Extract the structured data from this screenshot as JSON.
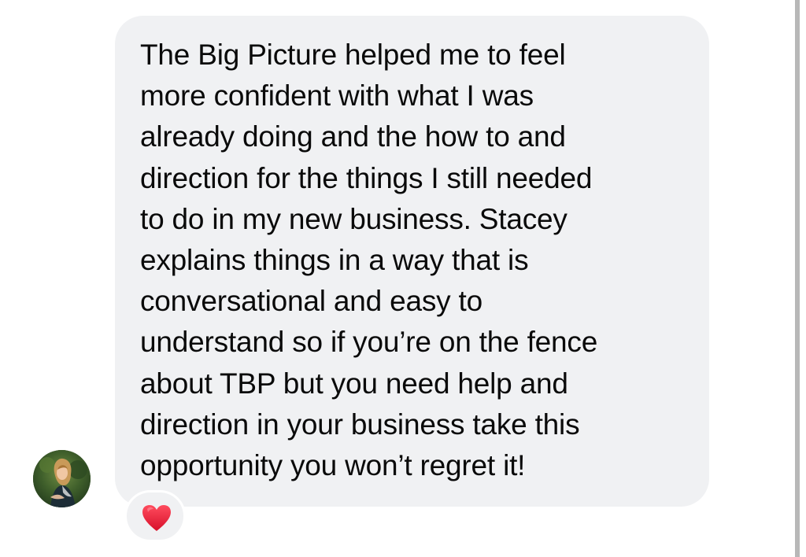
{
  "message": {
    "text": "The Big Picture helped me to feel\nmore confident with what I was\nalready doing and the how to and\ndirection for the things I still needed\nto do in my new business. Stacey\nexplains things in a way that is\nconversational and easy to\nunderstand so if you’re on the fence\nabout TBP but you need help and\ndirection in your business take this\nopportunity you won’t regret it!",
    "bubble_color": "#f0f1f3",
    "text_color": "#0a0a0a"
  },
  "sender": {
    "avatar_icon": "profile-photo-woman"
  },
  "reaction": {
    "icon": "red-heart-icon",
    "color": "#f0253a"
  }
}
